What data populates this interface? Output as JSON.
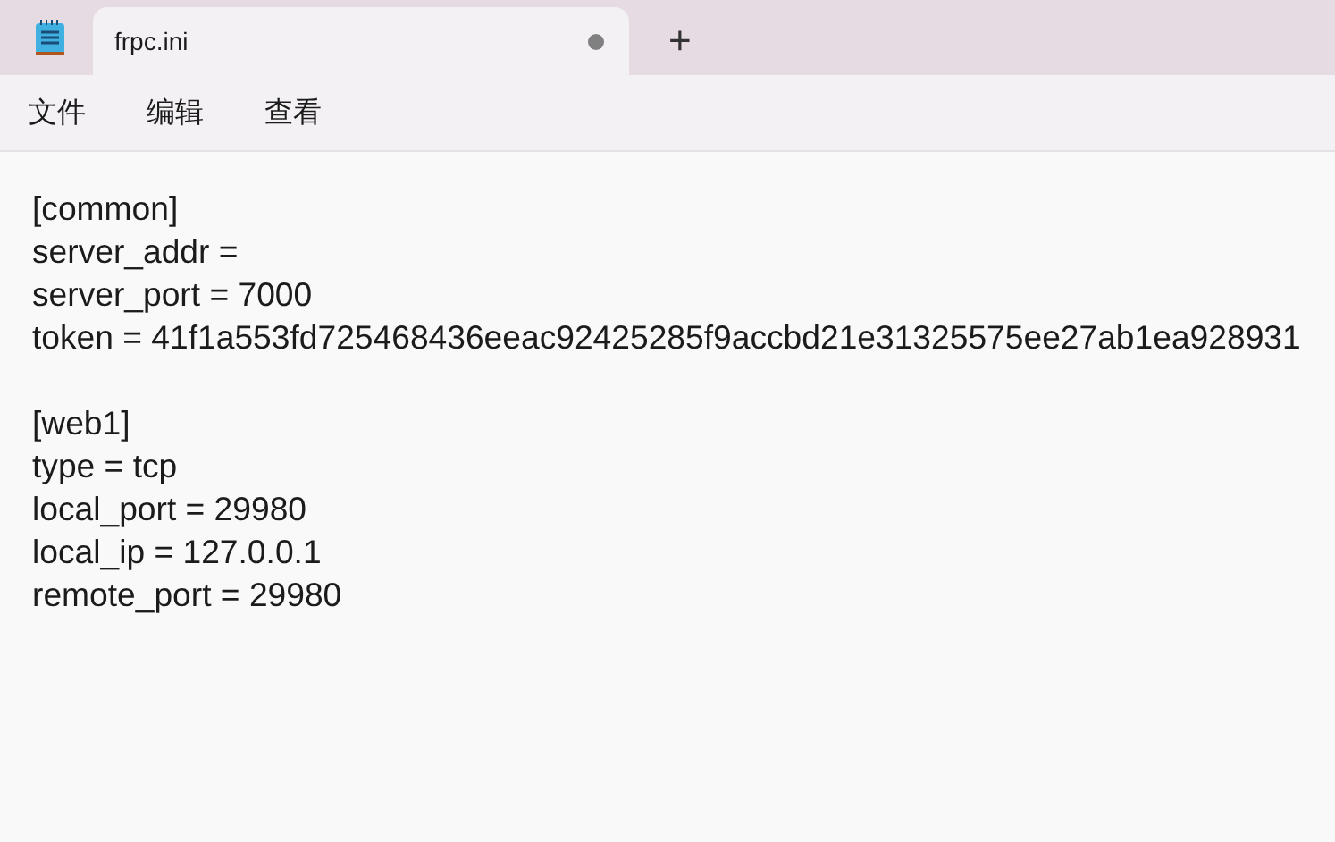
{
  "tabs": [
    {
      "title": "frpc.ini",
      "selected": true,
      "unsaved": true
    }
  ],
  "new_tab_button": "+",
  "menu": [
    "文件",
    "编辑",
    "查看"
  ],
  "sections": [
    {
      "lines": [
        "[common]",
        "server_addr =",
        "server_port = 7000",
        "token = 41f1a553fd725468436eeac92425285f9accbd21e31325575ee27ab1ea928931"
      ]
    },
    {
      "lines": [
        "[web1]",
        "type = tcp",
        "local_port = 29980",
        "local_ip = 127.0.0.1",
        "remote_port = 29980"
      ]
    }
  ]
}
